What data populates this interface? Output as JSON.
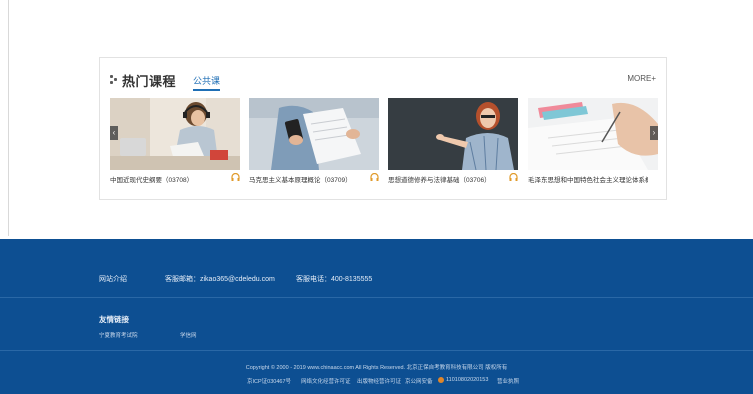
{
  "hot_courses": {
    "title": "热门课程",
    "tab": "公共课",
    "more": "MORE+",
    "arrows": {
      "prev": "‹",
      "next": "›"
    },
    "courses": [
      {
        "caption": "中国近现代史纲要（03708）",
        "icon": "headphones-icon"
      },
      {
        "caption": "马克思主义基本原理概论（03709）",
        "icon": "headphones-icon"
      },
      {
        "caption": "思想道德修养与法律基础（03706）",
        "icon": "headphones-icon"
      },
      {
        "caption": "毛泽东思想和中国特色社会主义理论体系概",
        "icon": "headphones-icon"
      }
    ]
  },
  "footer": {
    "about": "网站介绍",
    "email": "客服邮箱：zikao365@cdeledu.com",
    "phone": "客服电话：400-8135555",
    "friend_links_title": "友情链接",
    "friend_links": [
      "宁夏教育考试院",
      "学信网"
    ],
    "copyright": "Copyright © 2000 - 2019 www.chinaacc.com All Rights Reserved.  北京正保自考教育科技有限公司 版权所有",
    "icp": "京ICP证030467号",
    "license1": "网络文化经营许可证",
    "license2": "出版物经营许可证",
    "police": "京公网安备",
    "police_no": "11010802020153",
    "license3": "营业执照",
    "colors": {
      "footer_bg": "#0d4f92",
      "accent": "#1f6fb5"
    }
  }
}
